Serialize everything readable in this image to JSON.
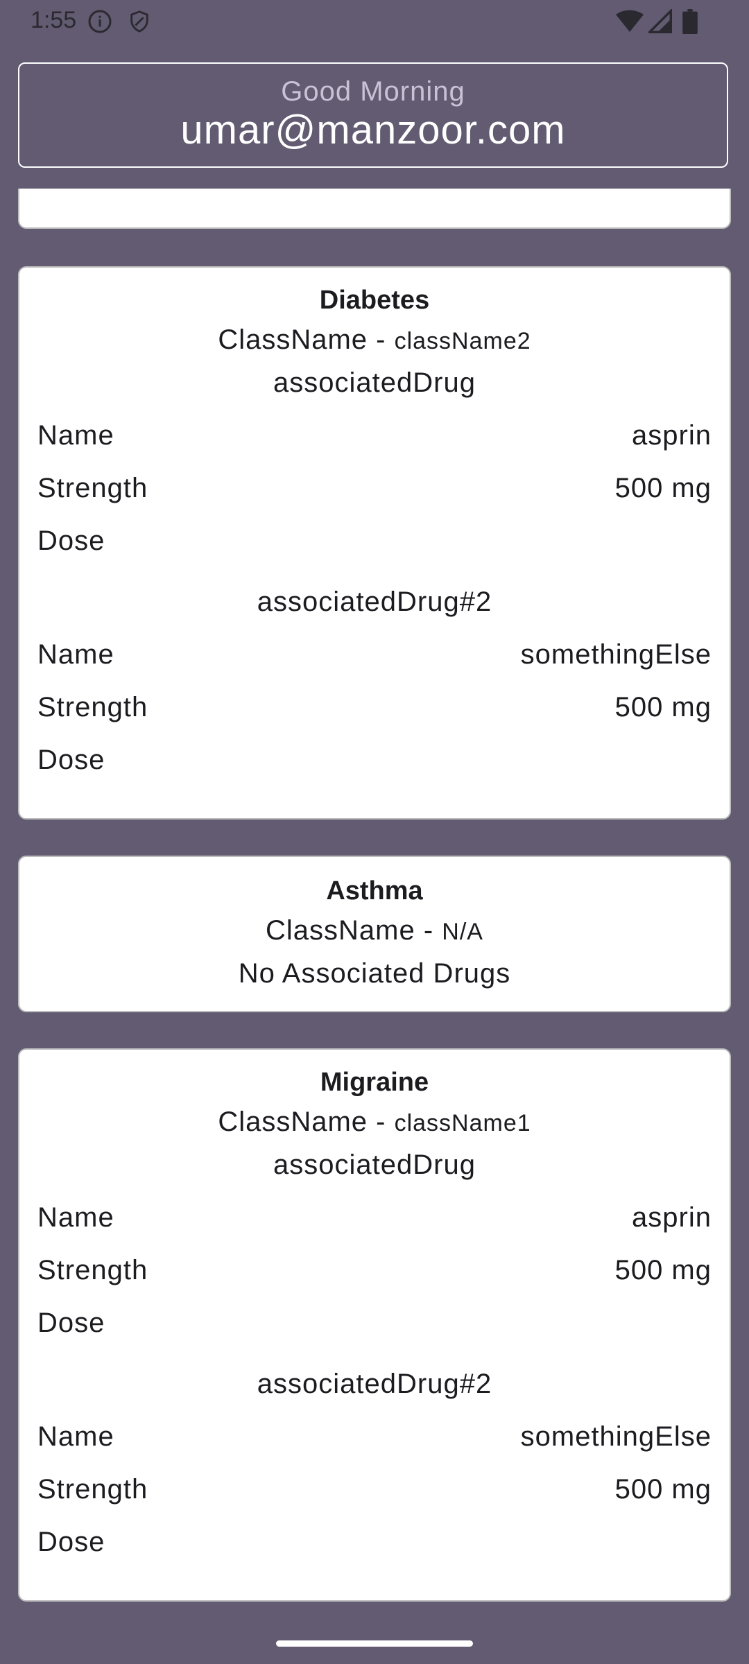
{
  "status_bar": {
    "time": "1:55"
  },
  "header": {
    "greeting": "Good Morning",
    "email": "umar@manzoor.com"
  },
  "cards": [
    {
      "title": "Diabetes",
      "class_label": "ClassName - ",
      "class_value": "className2",
      "drugs": [
        {
          "heading": "associatedDrug",
          "name_label": "Name",
          "name": "asprin",
          "strength_label": "Strength",
          "strength": "500 mg",
          "dose_label": "Dose",
          "dose": ""
        },
        {
          "heading": "associatedDrug#2",
          "name_label": "Name",
          "name": "somethingElse",
          "strength_label": "Strength",
          "strength": "500 mg",
          "dose_label": "Dose",
          "dose": ""
        }
      ]
    },
    {
      "title": "Asthma",
      "class_label": "ClassName - ",
      "class_value": "N/A",
      "no_drugs": "No Associated Drugs"
    },
    {
      "title": "Migraine",
      "class_label": "ClassName - ",
      "class_value": "className1",
      "drugs": [
        {
          "heading": "associatedDrug",
          "name_label": "Name",
          "name": "asprin",
          "strength_label": "Strength",
          "strength": "500 mg",
          "dose_label": "Dose",
          "dose": ""
        },
        {
          "heading": "associatedDrug#2",
          "name_label": "Name",
          "name": "somethingElse",
          "strength_label": "Strength",
          "strength": "500 mg",
          "dose_label": "Dose",
          "dose": ""
        }
      ]
    }
  ],
  "colors": {
    "background": "#625b71",
    "card": "#ffffff",
    "header_border": "#ffffff"
  }
}
